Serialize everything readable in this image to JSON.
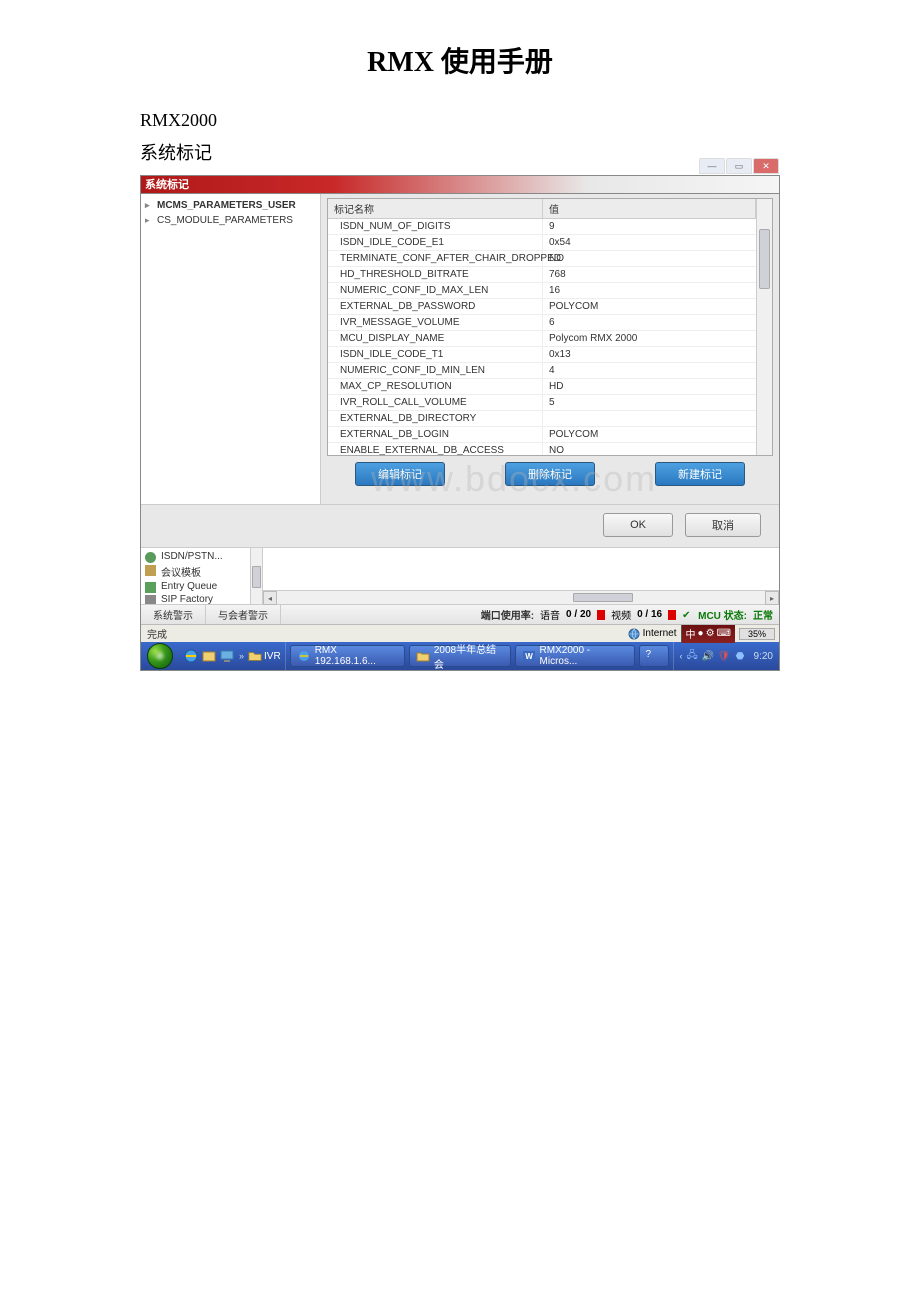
{
  "doc": {
    "title": "RMX 使用手册",
    "product": "RMX2000",
    "section": "系统标记"
  },
  "dialog": {
    "title": "系统标记",
    "tree": {
      "item0": "MCMS_PARAMETERS_USER",
      "item1": "CS_MODULE_PARAMETERS"
    },
    "grid": {
      "col_name": "标记名称",
      "col_value": "值",
      "rows": {
        "0": {
          "n": "ISDN_NUM_OF_DIGITS",
          "v": "9"
        },
        "1": {
          "n": "ISDN_IDLE_CODE_E1",
          "v": "0x54"
        },
        "2": {
          "n": "TERMINATE_CONF_AFTER_CHAIR_DROPPED",
          "v": "NO"
        },
        "3": {
          "n": "HD_THRESHOLD_BITRATE",
          "v": "768"
        },
        "4": {
          "n": "NUMERIC_CONF_ID_MAX_LEN",
          "v": "16"
        },
        "5": {
          "n": "EXTERNAL_DB_PASSWORD",
          "v": "POLYCOM"
        },
        "6": {
          "n": "IVR_MESSAGE_VOLUME",
          "v": "6"
        },
        "7": {
          "n": "MCU_DISPLAY_NAME",
          "v": "Polycom RMX 2000"
        },
        "8": {
          "n": "ISDN_IDLE_CODE_T1",
          "v": "0x13"
        },
        "9": {
          "n": "NUMERIC_CONF_ID_MIN_LEN",
          "v": "4"
        },
        "10": {
          "n": "MAX_CP_RESOLUTION",
          "v": "HD"
        },
        "11": {
          "n": "IVR_ROLL_CALL_VOLUME",
          "v": "5"
        },
        "12": {
          "n": "EXTERNAL_DB_DIRECTORY",
          "v": ""
        },
        "13": {
          "n": "EXTERNAL_DB_LOGIN",
          "v": "POLYCOM"
        },
        "14": {
          "n": "ENABLE_EXTERNAL_DB_ACCESS",
          "v": "NO"
        }
      }
    },
    "buttons": {
      "edit": "编辑标记",
      "delete": "删除标记",
      "new": "新建标记",
      "ok": "OK",
      "cancel": "取消"
    },
    "watermark": "www.bdocx.com"
  },
  "nav": {
    "isdn": "ISDN/PSTN...",
    "template": "会议模板",
    "eq": "Entry Queue",
    "sip": "SIP Factory"
  },
  "hint": {
    "sys": "系统警示",
    "part": "与会者警示",
    "port_label": "端口使用率:",
    "voice_label": "语音",
    "voice_val": "0 / 20",
    "video_label": "视频",
    "video_val": "0 / 16",
    "mcu_label": "MCU 状态:",
    "mcu_val": "正常"
  },
  "ie": {
    "done": "完成",
    "zone": "Internet",
    "pct": "35%"
  },
  "lang": {
    "ime": "中"
  },
  "taskbar": {
    "ql_folder": "IVR",
    "tasks": {
      "0": "RMX 192.168.1.6...",
      "1": "2008半年总结会",
      "2": "RMX2000 - Micros..."
    },
    "clock": "9:20"
  }
}
